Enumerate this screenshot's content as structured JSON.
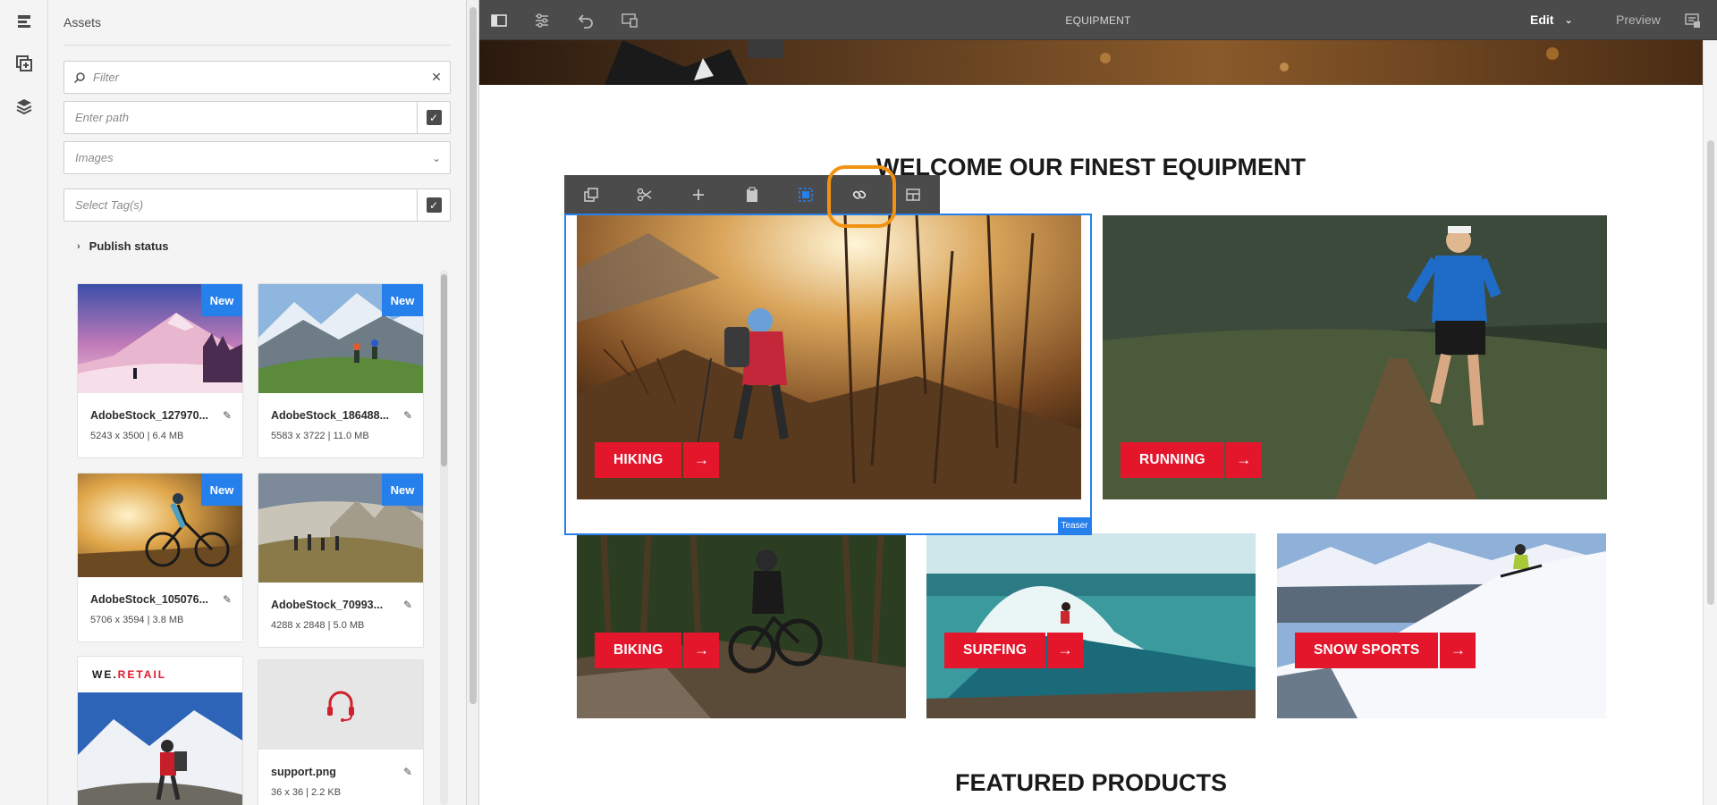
{
  "rail": {
    "items": [
      {
        "icon": "components-panel-icon"
      },
      {
        "icon": "assets-panel-icon"
      },
      {
        "icon": "content-tree-icon"
      }
    ]
  },
  "assets_panel": {
    "title": "Assets",
    "filter": {
      "placeholder": "Filter",
      "clear": "✕"
    },
    "path": {
      "placeholder": "Enter path"
    },
    "type_select": {
      "selected": "Images"
    },
    "tags": {
      "placeholder": "Select Tag(s)"
    },
    "publish_status": "Publish status",
    "cards": [
      {
        "name": "AdobeStock_127970...",
        "meta": "5243 x 3500 | 6.4 MB",
        "badge": "New"
      },
      {
        "name": "AdobeStock_186488...",
        "meta": "5583 x 3722 | 11.0 MB",
        "badge": "New"
      },
      {
        "name": "AdobeStock_105076...",
        "meta": "5706 x 3594 | 3.8 MB",
        "badge": "New"
      },
      {
        "name": "AdobeStock_70993...",
        "meta": "4288 x 2848 | 5.0 MB",
        "badge": "New"
      },
      {
        "name": "",
        "meta": "",
        "badge": "",
        "logo_text_we": "WE.",
        "logo_text_retail": "RETAIL"
      },
      {
        "name": "support.png",
        "meta": "36 x 36 | 2.2 KB",
        "badge": ""
      }
    ]
  },
  "topbar": {
    "title": "EQUIPMENT",
    "mode": "Edit",
    "preview": "Preview",
    "icons": [
      "side-panel-toggle-icon",
      "page-properties-icon",
      "undo-icon",
      "emulator-icon",
      "annotations-icon"
    ]
  },
  "page": {
    "welcome_heading": "WELCOME OUR FINEST EQUIPMENT",
    "featured_heading": "FEATURED PRODUCTS",
    "tiles": [
      {
        "label": "HIKING",
        "arrow": "→"
      },
      {
        "label": "RUNNING",
        "arrow": "→"
      },
      {
        "label": "BIKING",
        "arrow": "→"
      },
      {
        "label": "SURFING",
        "arrow": "→"
      },
      {
        "label": "SNOW SPORTS",
        "arrow": "→"
      }
    ]
  },
  "editor": {
    "selected_component": "Teaser",
    "toolbar": [
      "copy-icon",
      "cut-icon",
      "insert-icon",
      "paste-icon",
      "group-icon",
      "link-icon",
      "layout-icon"
    ],
    "highlighted_tool": "link-icon"
  },
  "colors": {
    "accent_blue": "#2680eb",
    "cta_red": "#e3162b",
    "highlight_orange": "#f29212",
    "topbar": "#4b4b4b"
  }
}
